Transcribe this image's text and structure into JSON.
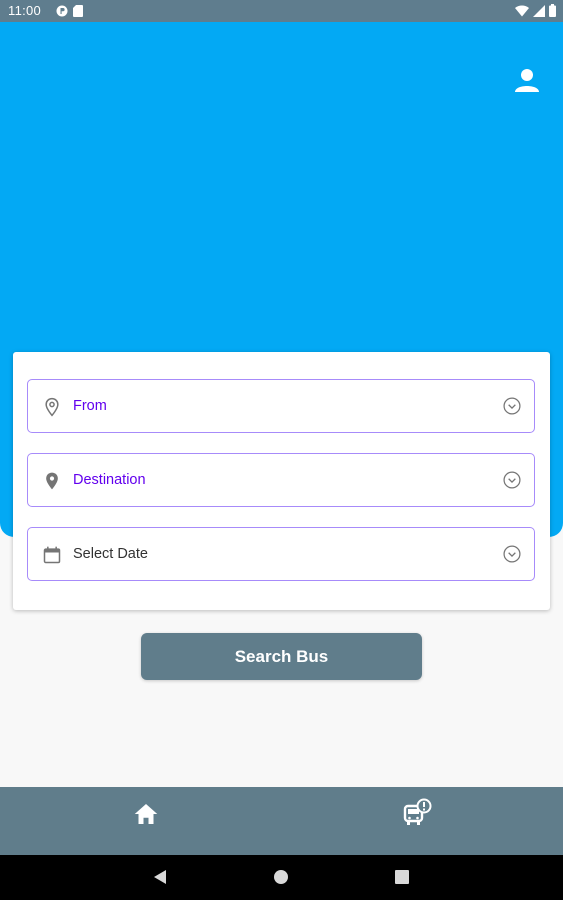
{
  "status_bar": {
    "time": "11:00",
    "left_icons": [
      "notification-p-icon",
      "sd-card-icon"
    ],
    "right_icons": [
      "wifi-icon",
      "signal-icon",
      "battery-icon"
    ]
  },
  "header": {
    "background_color": "#03a9f4",
    "profile_icon": "account-icon"
  },
  "search_form": {
    "from": {
      "label": "From",
      "lead_icon": "location-outline-icon",
      "trail_icon": "dropdown-circle-icon"
    },
    "destination": {
      "label": "Destination",
      "lead_icon": "location-filled-icon",
      "trail_icon": "dropdown-circle-icon"
    },
    "date": {
      "label": "Select Date",
      "lead_icon": "calendar-icon",
      "trail_icon": "dropdown-circle-icon"
    },
    "field_border_color": "#a78bfa",
    "label_color": "#6200ee"
  },
  "actions": {
    "search_label": "Search Bus",
    "button_color": "#607d8b"
  },
  "bottom_nav": {
    "items": [
      {
        "name": "home",
        "icon": "home-icon"
      },
      {
        "name": "bus-alert",
        "icon": "bus-alert-icon"
      }
    ],
    "background_color": "#607d8b"
  },
  "system_nav": {
    "buttons": [
      "back-icon",
      "home-circle-icon",
      "recents-icon"
    ]
  }
}
